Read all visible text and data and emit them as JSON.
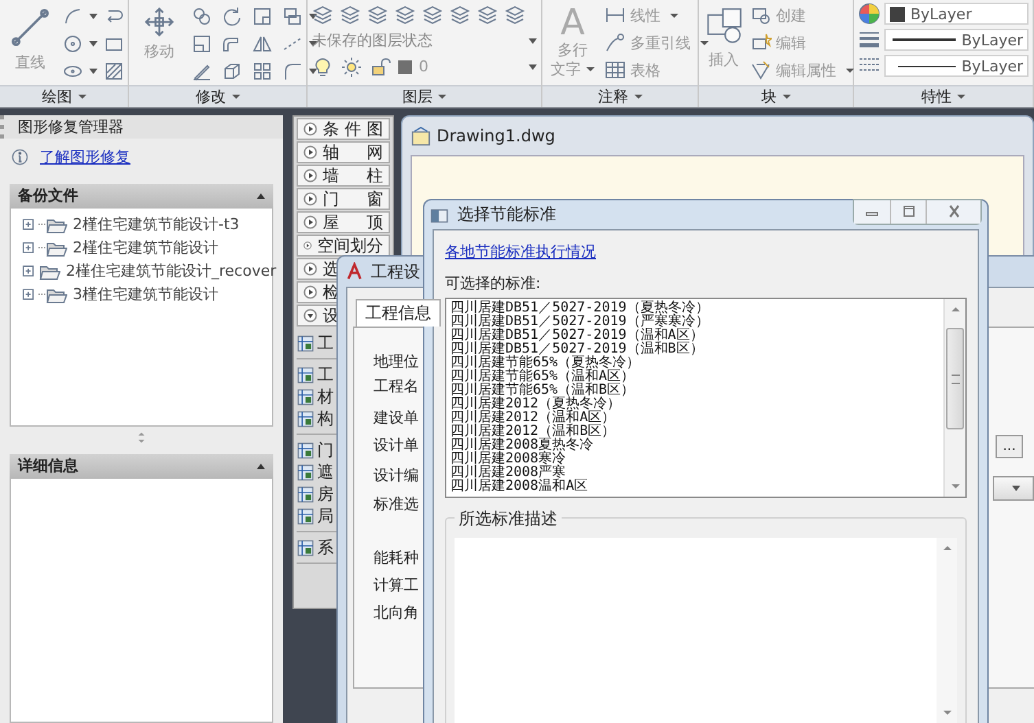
{
  "ribbon": {
    "panels": [
      {
        "kind": "draw",
        "label": "绘图",
        "big_button": "直线"
      },
      {
        "kind": "modify",
        "label": "修改",
        "big_button": "移动"
      },
      {
        "kind": "layer",
        "label": "图层",
        "layer_state": "未保存的图层状态",
        "current_layer": "0"
      },
      {
        "kind": "annotate",
        "label": "注释",
        "big_glyph": "A",
        "big_button": [
          "多行",
          "文字"
        ],
        "items": [
          {
            "label": "线性",
            "dropdown": true
          },
          {
            "label": "多重引线",
            "dropdown": true
          },
          {
            "label": "表格",
            "dropdown": false
          }
        ]
      },
      {
        "kind": "block",
        "label": "块",
        "big_button": "插入",
        "items": [
          {
            "label": "创建",
            "dropdown": false
          },
          {
            "label": "编辑",
            "dropdown": false
          },
          {
            "label": "编辑属性",
            "dropdown": true
          }
        ]
      },
      {
        "kind": "properties",
        "label": "特性",
        "items": [
          "ByLayer",
          "ByLayer",
          "ByLayer"
        ]
      }
    ]
  },
  "recovery_panel": {
    "title": "图形修复管理器",
    "link": "了解图形修复",
    "backup_section": "备份文件",
    "details_section": "详细信息",
    "files": [
      "2槿住宅建筑节能设计-t3",
      "2槿住宅建筑节能设计",
      "2槿住宅建筑节能设计_recover",
      "3槿住宅建筑节能设计"
    ]
  },
  "tool_palette": {
    "headers": [
      {
        "label": "条 件 图",
        "expanded": false
      },
      {
        "label": "轴 网",
        "expanded": false
      },
      {
        "label": "墙 柱",
        "expanded": false
      },
      {
        "label": "门 窗",
        "expanded": false
      },
      {
        "label": "屋 顶",
        "expanded": false
      },
      {
        "label": "空间划分",
        "expanded": false
      },
      {
        "label": "选",
        "expanded": false
      },
      {
        "label": "检",
        "expanded": false
      },
      {
        "label": "设",
        "expanded": true
      }
    ],
    "tool_groups": [
      [
        "工"
      ],
      [
        "工",
        "材",
        "构"
      ],
      [
        "门",
        "遮",
        "房",
        "局"
      ],
      [
        "系"
      ]
    ]
  },
  "drawing_window": {
    "title": "Drawing1.dwg"
  },
  "project_dialog": {
    "title": "工程设",
    "tab": "工程信息",
    "fields": [
      "地理位",
      "工程名",
      "建设单",
      "设计单",
      "设计编",
      "标准选",
      "能耗种",
      "计算工",
      "北向角"
    ],
    "browse_button": "..."
  },
  "standard_dialog": {
    "title": "选择节能标准",
    "link": "各地节能标准执行情况",
    "list_label": "可选择的标准:",
    "description_group": "所选标准描述",
    "standards": [
      {
        "label": "四川居建DB51／5027-2019（夏热冬冷）",
        "selected": false
      },
      {
        "label": "四川居建DB51／5027-2019（严寒寒冷）",
        "selected": false
      },
      {
        "label": "四川居建DB51／5027-2019（温和A区）",
        "selected": false
      },
      {
        "label": "四川居建DB51／5027-2019（温和B区）",
        "selected": false
      },
      {
        "label": "四川居建节能65%（夏热冬冷）",
        "selected": false
      },
      {
        "label": "四川居建节能65%（温和A区）",
        "selected": false
      },
      {
        "label": "四川居建节能65%（温和B区）",
        "selected": false
      },
      {
        "label": "四川居建2012（夏热冬冷）",
        "selected": false
      },
      {
        "label": "四川居建2012（温和A区）",
        "selected": false
      },
      {
        "label": "四川居建2012（温和B区）",
        "selected": false
      },
      {
        "label": "四川居建2008夏热冬冷",
        "selected": false
      },
      {
        "label": "四川居建2008寒冷",
        "selected": false
      },
      {
        "label": "四川居建2008严寒",
        "selected": false
      },
      {
        "label": "四川居建2008温和A区",
        "selected": false
      }
    ]
  }
}
